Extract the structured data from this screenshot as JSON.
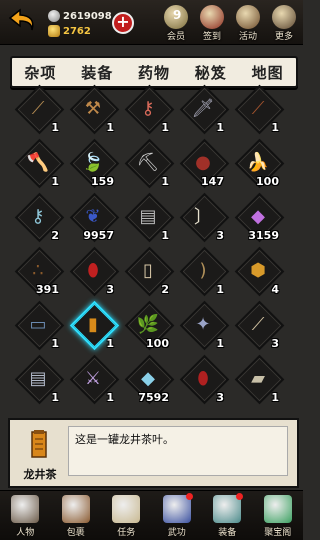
{
  "currency": {
    "silver": "2619098",
    "gold": "2762"
  },
  "top_icons": [
    {
      "label": "会员",
      "badge": "9",
      "icon": "vip-icon",
      "color": "#7a6b3a"
    },
    {
      "label": "签到",
      "badge": "",
      "icon": "signin-icon",
      "color": "#8b2a1e"
    },
    {
      "label": "活动",
      "badge": "",
      "icon": "event-icon",
      "color": "#6b4a2a"
    },
    {
      "label": "更多",
      "badge": "",
      "icon": "more-icon",
      "color": "#5a4530"
    }
  ],
  "tabs": [
    "杂项",
    "装备",
    "药物",
    "秘笈",
    "地图"
  ],
  "active_tab": 0,
  "items": [
    {
      "count": "1",
      "icon": "staff-icon",
      "glyph": "⟋",
      "color": "#b08850"
    },
    {
      "count": "1",
      "icon": "hammer-icon",
      "glyph": "⚒",
      "color": "#c0894a"
    },
    {
      "count": "1",
      "icon": "key-icon",
      "glyph": "⚷",
      "color": "#d96a5a"
    },
    {
      "count": "1",
      "icon": "dagger-icon",
      "glyph": "🗡",
      "color": "#aab"
    },
    {
      "count": "1",
      "icon": "blade-icon",
      "glyph": "⟋",
      "color": "#a0522d"
    },
    {
      "count": "1",
      "icon": "axe-icon",
      "glyph": "🪓",
      "color": "#a8a0e0"
    },
    {
      "count": "159",
      "icon": "leaf-icon",
      "glyph": "🍃",
      "color": "#6abf4a"
    },
    {
      "count": "1",
      "icon": "pickaxe-icon",
      "glyph": "⛏",
      "color": "#ccc"
    },
    {
      "count": "147",
      "icon": "beans-icon",
      "glyph": "●",
      "color": "#a03028"
    },
    {
      "count": "100",
      "icon": "banana-icon",
      "glyph": "🍌",
      "color": "#f2d034"
    },
    {
      "count": "2",
      "icon": "skeleton-key-icon",
      "glyph": "⚷",
      "color": "#8ec6d8"
    },
    {
      "count": "9957",
      "icon": "herb-icon",
      "glyph": "❦",
      "color": "#3a58c8"
    },
    {
      "count": "1",
      "icon": "book-icon",
      "glyph": "▤",
      "color": "#b8b8b8"
    },
    {
      "count": "3",
      "icon": "fang-icon",
      "glyph": "〕",
      "color": "#e8e2cf"
    },
    {
      "count": "3159",
      "icon": "crystal-icon",
      "glyph": "◆",
      "color": "#c070e0"
    },
    {
      "count": "391",
      "icon": "seeds-icon",
      "glyph": "∴",
      "color": "#8b5a2b"
    },
    {
      "count": "3",
      "icon": "lantern-icon",
      "glyph": "⬮",
      "color": "#c02020"
    },
    {
      "count": "2",
      "icon": "bone-icon",
      "glyph": "▯",
      "color": "#d8c8a8"
    },
    {
      "count": "1",
      "icon": "bow-icon",
      "glyph": ")",
      "color": "#b0905a"
    },
    {
      "count": "4",
      "icon": "turtle-icon",
      "glyph": "⬢",
      "color": "#d89a2a"
    },
    {
      "count": "1",
      "icon": "scroll-icon",
      "glyph": "▭",
      "color": "#6a8ab0"
    },
    {
      "count": "1",
      "icon": "tea-box-icon",
      "glyph": "▮",
      "color": "#d88a1a",
      "selected": true
    },
    {
      "count": "100",
      "icon": "tea-leaf-icon",
      "glyph": "🌿",
      "color": "#3a9a3a"
    },
    {
      "count": "1",
      "icon": "claw-icon",
      "glyph": "✦",
      "color": "#9aa4c8"
    },
    {
      "count": "3",
      "icon": "spear-icon",
      "glyph": "⟋",
      "color": "#d0c0a0"
    },
    {
      "count": "1",
      "icon": "map-icon",
      "glyph": "▤",
      "color": "#b0b8c8"
    },
    {
      "count": "1",
      "icon": "sickle-icon",
      "glyph": "⚔",
      "color": "#c0a0e0"
    },
    {
      "count": "7592",
      "icon": "ice-crystal-icon",
      "glyph": "◆",
      "color": "#8ad0e8"
    },
    {
      "count": "3",
      "icon": "jar-icon",
      "glyph": "⬮",
      "color": "#b02020"
    },
    {
      "count": "1",
      "icon": "tome-icon",
      "glyph": "▰",
      "color": "#c8c0a8"
    }
  ],
  "detail": {
    "name": "龙井茶",
    "description": "这是一罐龙井茶叶。"
  },
  "bottom_nav": [
    {
      "label": "人物",
      "icon": "character-icon",
      "color": "#6b5a48",
      "dot": false
    },
    {
      "label": "包裹",
      "icon": "bag-icon",
      "color": "#8a5a30",
      "dot": false
    },
    {
      "label": "任务",
      "icon": "quest-icon",
      "color": "#c8b890",
      "dot": false
    },
    {
      "label": "武功",
      "icon": "martial-arts-icon",
      "color": "#3a50a0",
      "dot": true
    },
    {
      "label": "装备",
      "icon": "equipment-icon",
      "color": "#4a8a8a",
      "dot": true
    },
    {
      "label": "聚宝阁",
      "icon": "treasure-shop-icon",
      "color": "#3aa060",
      "dot": false
    }
  ]
}
